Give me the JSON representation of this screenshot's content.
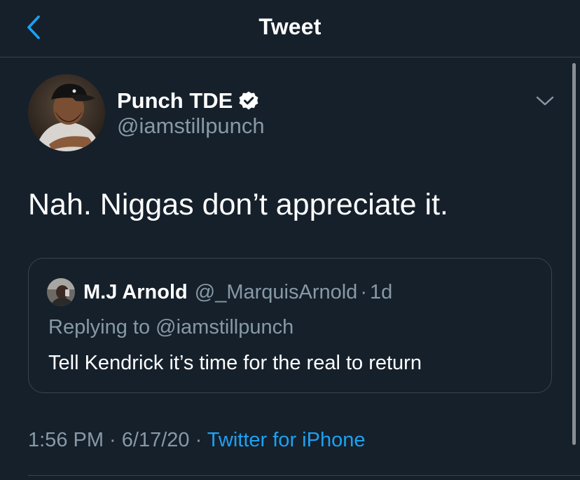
{
  "nav": {
    "title": "Tweet",
    "back_icon": "chevron-left-icon"
  },
  "colors": {
    "background": "#15202b",
    "accent": "#1da1f2",
    "secondary_text": "#8899a6",
    "border": "#38444d"
  },
  "tweet": {
    "author_name": "Punch TDE",
    "author_handle": "@iamstillpunch",
    "verified": true,
    "text": "Nah. Niggas don’t appreciate it.",
    "quoted": {
      "author_name": "M.J Arnold",
      "author_handle": "@_MarquisArnold",
      "separator": "·",
      "time": "1d",
      "replying_prefix": "Replying to ",
      "replying_to": "@iamstillpunch",
      "text": "Tell Kendrick it’s time for the real to return"
    },
    "meta": {
      "time": "1:56 PM",
      "sep1": " · ",
      "date": "6/17/20",
      "sep2": " · ",
      "source": "Twitter for iPhone"
    }
  }
}
